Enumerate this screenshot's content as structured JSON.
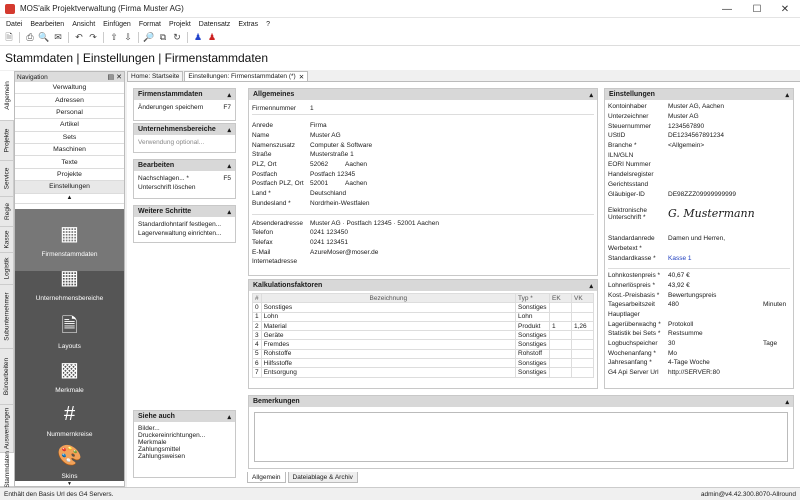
{
  "window": {
    "title": "MOS'aik Projektverwaltung (Firma Muster AG)"
  },
  "menu": [
    "Datei",
    "Bearbeiten",
    "Ansicht",
    "Einfügen",
    "Format",
    "Projekt",
    "Datensatz",
    "Extras",
    "?"
  ],
  "page_title": "Stammdaten | Einstellungen | Firmenstammdaten",
  "vertical_tabs": [
    "Allgemein",
    "Projekte",
    "Service",
    "Regie",
    "Kasse",
    "Logistik",
    "Subunternehmer",
    "Büroarbeiten",
    "Auswertungen",
    "Stammdaten"
  ],
  "navigation": {
    "title": "Navigation",
    "items": [
      "Verwaltung",
      "Adressen",
      "Personal",
      "Artikel",
      "Sets",
      "Maschinen",
      "Texte",
      "Projekte",
      "Einstellungen"
    ],
    "big_items": [
      {
        "label": "Firmenstammdaten",
        "icon": "company-settings-icon"
      },
      {
        "label": "Unternehmensbereiche",
        "icon": "grid-icon"
      },
      {
        "label": "Layouts",
        "icon": "layouts-icon"
      },
      {
        "label": "Merkmale",
        "icon": "merkmale-icon"
      },
      {
        "label": "Nummernkreise",
        "icon": "hash-icon"
      },
      {
        "label": "Skins",
        "icon": "palette-icon"
      }
    ]
  },
  "doc_tabs": [
    "Home: Startseite",
    "Einstellungen: Firmenstammdaten (*)"
  ],
  "left_panels": {
    "firmenstammdaten": {
      "title": "Firmenstammdaten",
      "action": "Änderungen speichern",
      "shortcut": "F7"
    },
    "unternehmensbereiche": {
      "title": "Unternehmensbereiche",
      "action": "Verwendung optional..."
    },
    "bearbeiten": {
      "title": "Bearbeiten",
      "action1": "Nachschlagen... *",
      "shortcut1": "F5",
      "action2": "Unterschrift löschen"
    },
    "weitere": {
      "title": "Weitere Schritte",
      "action1": "Standardlohntarif festlegen...",
      "action2": "Lagerverwaltung einrichten..."
    },
    "siehe": {
      "title": "Siehe auch",
      "items": [
        "Bilder...",
        "Druckereinrichtungen...",
        "Merkmale",
        "Zahlungsmittel",
        "Zahlungsweisen"
      ]
    }
  },
  "allgemeines": {
    "title": "Allgemeines",
    "firmennummer_label": "Firmennummer",
    "firmennummer": "1",
    "anrede_label": "Anrede",
    "anrede": "Firma",
    "name_label": "Name",
    "name": "Muster AG",
    "namenszusatz_label": "Namenszusatz",
    "namenszusatz": "Computer & Software",
    "strasse_label": "Straße",
    "strasse": "Musterstraße 1",
    "plz_label": "PLZ, Ort",
    "plz": "52062",
    "ort": "Aachen",
    "postfach_label": "Postfach",
    "postfach": "Postfach 12345",
    "postfach_plz_label": "Postfach PLZ, Ort",
    "postfach_plz": "52001",
    "postfach_ort": "Aachen",
    "land_label": "Land *",
    "land": "Deutschland",
    "bundesland_label": "Bundesland *",
    "bundesland": "Nordrhein-Westfalen",
    "absender_label": "Absenderadresse",
    "absender": "Muster AG · Postfach 12345 · 52001 Aachen",
    "telefon_label": "Telefon",
    "telefon": "0241 123450",
    "telefax_label": "Telefax",
    "telefax": "0241 123451",
    "email_label": "E-Mail",
    "email": "AzureMoser@moser.de",
    "internet_label": "Internetadresse",
    "internet": ""
  },
  "kalkulation": {
    "title": "Kalkulationsfaktoren",
    "headers": [
      "#",
      "Bezeichnung",
      "Typ *",
      "EK",
      "VK"
    ],
    "rows": [
      [
        "0",
        "Sonstiges",
        "Sonstiges",
        "",
        ""
      ],
      [
        "1",
        "Lohn",
        "Lohn",
        "",
        ""
      ],
      [
        "2",
        "Material",
        "Produkt",
        "1",
        "1,26"
      ],
      [
        "3",
        "Geräte",
        "Sonstiges",
        "",
        ""
      ],
      [
        "4",
        "Fremdes",
        "Sonstiges",
        "",
        ""
      ],
      [
        "5",
        "Rohstoffe",
        "Rohstoff",
        "",
        ""
      ],
      [
        "6",
        "Hilfsstoffe",
        "Sonstiges",
        "",
        ""
      ],
      [
        "7",
        "Entsorgung",
        "Sonstiges",
        "",
        ""
      ]
    ]
  },
  "einstellungen": {
    "title": "Einstellungen",
    "rows1": [
      [
        "Kontoinhaber",
        "Muster AG, Aachen"
      ],
      [
        "Unterzeichner",
        "Muster AG"
      ],
      [
        "Steuernummer",
        "1234567890"
      ],
      [
        "UStID",
        "DE1234567891234"
      ],
      [
        "Branche *",
        "<Allgemein>"
      ],
      [
        "ILN/GLN",
        ""
      ],
      [
        "EORI Nummer",
        ""
      ],
      [
        "Handelsregister",
        ""
      ],
      [
        "Gerichtsstand",
        ""
      ],
      [
        "Gläubiger-ID",
        "DE98ZZZ09999999999"
      ]
    ],
    "unterschrift_label": "Elektronische Unterschrift *",
    "unterschrift": "G. Mustermann",
    "rows2": [
      [
        "Standardanrede",
        "Damen und Herren,"
      ],
      [
        "Werbetext *",
        ""
      ],
      [
        "Standardkasse *",
        "Kasse 1"
      ]
    ],
    "rows3": [
      [
        "Lohnkostenpreis *",
        "40,67 €",
        ""
      ],
      [
        "Lohnerlöspreis *",
        "43,92 €",
        ""
      ],
      [
        "Kost.-Preisbasis *",
        "Bewertungspreis",
        ""
      ],
      [
        "Tagesarbeitszeit",
        "480",
        "Minuten"
      ],
      [
        "Hauptlager",
        "",
        ""
      ],
      [
        "Lagerüberwachg *",
        "Protokoll",
        ""
      ],
      [
        "Statistik bei Sets *",
        "Restsumme",
        ""
      ],
      [
        "Logbuchspeicher",
        "30",
        "Tage"
      ],
      [
        "Wochenanfang *",
        "Mo",
        ""
      ],
      [
        "Jahresanfang *",
        "4-Tage Woche",
        ""
      ],
      [
        "G4 Api Server Url",
        "http://SERVER:80",
        ""
      ]
    ]
  },
  "bemerkungen": {
    "title": "Bemerkungen"
  },
  "bottom_tabs": [
    "Allgemein",
    "Dateiablage & Archiv"
  ],
  "status": {
    "left": "Enthält den Basis Url des G4 Servers.",
    "right": "admin@v4.42.300.8070-Allround"
  }
}
